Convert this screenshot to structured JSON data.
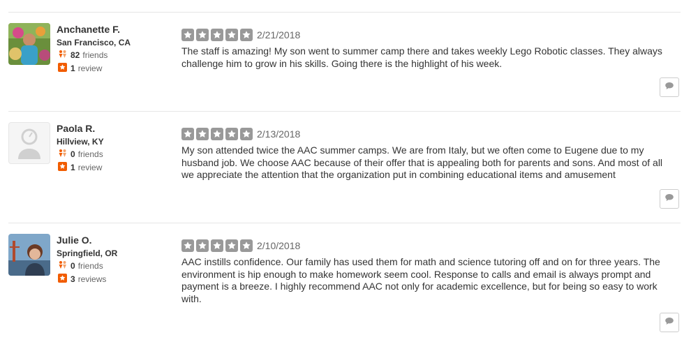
{
  "reviews": [
    {
      "user": {
        "name": "Anchanette F.",
        "location": "San Francisco, CA",
        "friends_count": "82",
        "friends_label": "friends",
        "reviews_count": "1",
        "reviews_label": "review",
        "avatar": "user-photo"
      },
      "rating": 5,
      "date": "2/21/2018",
      "text": "The staff is amazing! My son went to summer camp there and takes weekly Lego Robotic classes. They always challenge him to grow in his skills. Going there is the highlight of his week."
    },
    {
      "user": {
        "name": "Paola R.",
        "location": "Hillview, KY",
        "friends_count": "0",
        "friends_label": "friends",
        "reviews_count": "1",
        "reviews_label": "review",
        "avatar": "default-user-icon"
      },
      "rating": 5,
      "date": "2/13/2018",
      "text": "My son attended twice the AAC summer camps. We are from Italy, but we often come to Eugene due to my husband job. We choose AAC because of their offer that is appealing both for parents and sons. And most of all we appreciate the attention that the organization put in combining educational items and amusement"
    },
    {
      "user": {
        "name": "Julie O.",
        "location": "Springfield, OR",
        "friends_count": "0",
        "friends_label": "friends",
        "reviews_count": "3",
        "reviews_label": "reviews",
        "avatar": "user-photo"
      },
      "rating": 5,
      "date": "2/10/2018",
      "text": "AAC instills confidence. Our family has used them for math and science tutoring off and on for three years. The environment is hip enough to make homework seem cool. Response to calls and email is always prompt and payment is a breeze. I highly recommend AAC not only for academic excellence, but for being so easy to work with."
    }
  ],
  "colors": {
    "star_fill": "#999999",
    "friends_icon": "#f15c00",
    "review_icon": "#f15c00",
    "divider": "#e6e6e6"
  },
  "icons": {
    "friends": "friends-icon",
    "review": "review-star-icon",
    "comment": "comment-bubble-icon"
  }
}
